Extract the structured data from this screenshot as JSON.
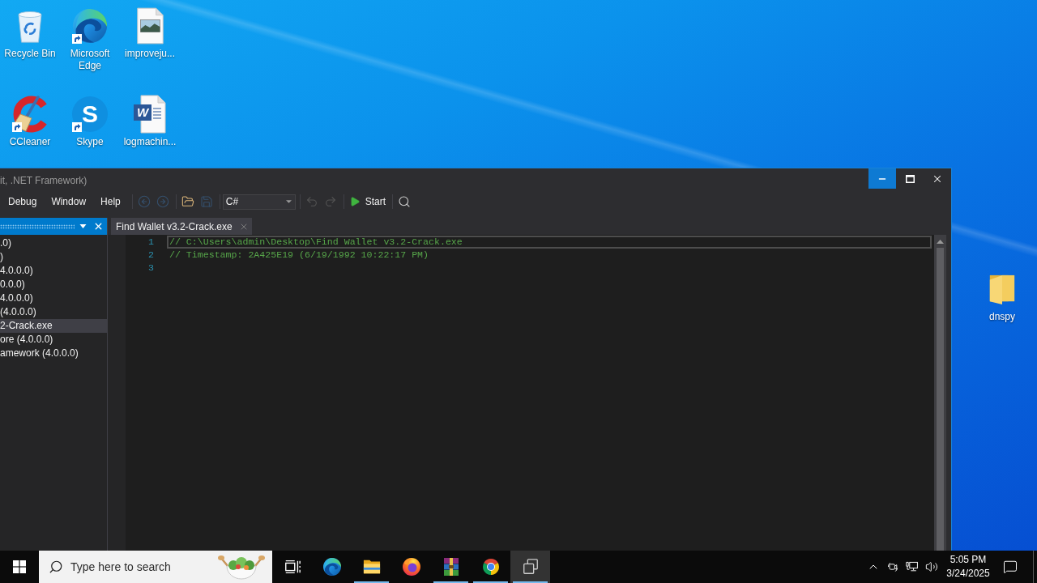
{
  "desktop": {
    "icons": [
      {
        "kind": "recycle-bin",
        "label": "Recycle Bin",
        "shortcut": false
      },
      {
        "kind": "edge",
        "label": "Microsoft Edge",
        "shortcut": true
      },
      {
        "kind": "image-file",
        "label": "improveju...",
        "shortcut": false
      },
      {
        "kind": "ccleaner",
        "label": "CCleaner",
        "shortcut": true
      },
      {
        "kind": "skype",
        "label": "Skype",
        "glyph": "S",
        "shortcut": true
      },
      {
        "kind": "word-document",
        "label": "logmachin...",
        "glyph": "W",
        "shortcut": false
      }
    ],
    "right_icons": [
      {
        "kind": "folder",
        "label": "dnspy",
        "shortcut": false
      }
    ]
  },
  "window": {
    "title": "it, .NET Framework)",
    "controls": [
      {
        "kind": "minimize",
        "hovered": true
      },
      {
        "kind": "maximize",
        "hovered": false
      },
      {
        "kind": "close",
        "hovered": false
      }
    ],
    "menu": [
      "Debug",
      "Window",
      "Help"
    ],
    "toolbar": [
      [
        {
          "kind": "back",
          "disabled": true
        },
        {
          "kind": "forward",
          "disabled": true
        }
      ],
      [
        {
          "kind": "open",
          "disabled": false
        },
        {
          "kind": "save",
          "disabled": true
        }
      ],
      [
        {
          "kind": "language",
          "value": "C#"
        }
      ],
      [
        {
          "kind": "undo",
          "disabled": true
        },
        {
          "kind": "redo",
          "disabled": true
        }
      ],
      [
        {
          "kind": "start",
          "label": "Start",
          "disabled": false
        }
      ],
      [
        {
          "kind": "search",
          "disabled": false
        }
      ]
    ],
    "explorer": {
      "items": [
        {
          "label": ".0)",
          "selected": false
        },
        {
          "label": ")",
          "selected": false
        },
        {
          "label": "4.0.0.0)",
          "selected": false
        },
        {
          "label": "0.0.0)",
          "selected": false
        },
        {
          "label": "4.0.0.0)",
          "selected": false
        },
        {
          "label": "(4.0.0.0)",
          "selected": false
        },
        {
          "label": "2-Crack.exe",
          "selected": true
        },
        {
          "label": "ore (4.0.0.0)",
          "selected": false
        },
        {
          "label": "amework (4.0.0.0)",
          "selected": false
        }
      ]
    },
    "tabs": [
      {
        "label": "Find Wallet v3.2-Crack.exe",
        "selected": true
      }
    ],
    "editor": {
      "lines": [
        {
          "number": "1",
          "kind": "comment",
          "text": "// C:\\Users\\admin\\Desktop\\Find Wallet v3.2-Crack.exe",
          "current": true
        },
        {
          "number": "2",
          "kind": "comment",
          "text": "// Timestamp: 2A425E19 (6/19/1992 10:22:17 PM)",
          "current": false
        },
        {
          "number": "3",
          "current": false
        }
      ]
    }
  },
  "taskbar": {
    "search": {
      "placeholder": "Type here to search"
    },
    "apps": [
      {
        "kind": "task-view",
        "running": false,
        "active": false
      },
      {
        "kind": "edge",
        "running": false,
        "active": false
      },
      {
        "kind": "file-explorer",
        "running": true,
        "active": false
      },
      {
        "kind": "firefox",
        "running": false,
        "active": false
      },
      {
        "kind": "winrar",
        "running": true,
        "active": false
      },
      {
        "kind": "chrome",
        "running": true,
        "active": false
      },
      {
        "kind": "windows",
        "running": true,
        "active": true
      }
    ],
    "tray": {
      "time": "5:05 PM",
      "date": "3/24/2025"
    }
  }
}
